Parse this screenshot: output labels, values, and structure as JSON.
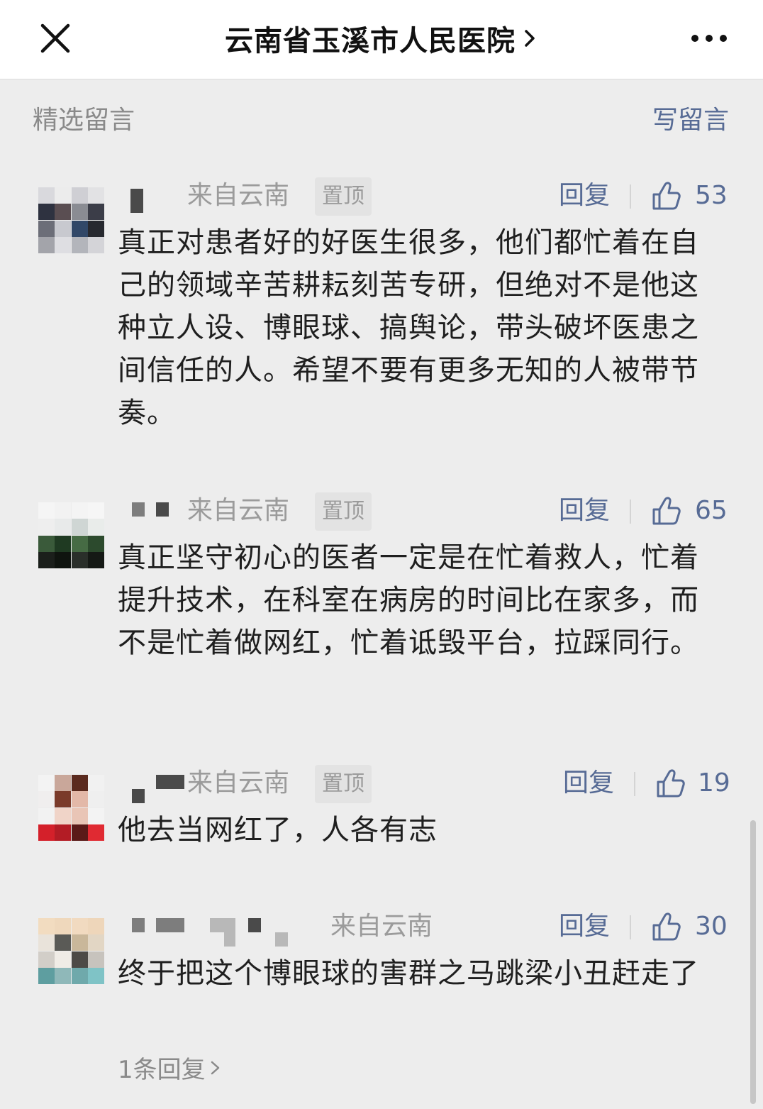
{
  "nav": {
    "title": "云南省玉溪市人民医院",
    "close_icon": "close-icon",
    "chevron_icon": "chevron-right-icon",
    "more_icon": "more-dots-icon"
  },
  "section": {
    "title": "精选留言",
    "write_label": "写留言"
  },
  "colors": {
    "link": "#576b95",
    "muted": "#9b9b9b",
    "background": "#ededed"
  },
  "comments": [
    {
      "location": "来自云南",
      "pinned_label": "置顶",
      "reply_label": "回复",
      "likes": "53",
      "text": "真正对患者好的好医生很多，他们都忙着在自己的领域辛苦耕耘刻苦专研，但绝对不是他这种立人设、博眼球、搞舆论，带头破坏医患之间信任的人。希望不要有更多无知的人被带节奏。"
    },
    {
      "location": "来自云南",
      "pinned_label": "置顶",
      "reply_label": "回复",
      "likes": "65",
      "text": "真正坚守初心的医者一定是在忙着救人，忙着提升技术，在科室在病房的时间比在家多，而不是忙着做网红，忙着诋毁平台，拉踩同行。"
    },
    {
      "location": "来自云南",
      "pinned_label": "置顶",
      "reply_label": "回复",
      "likes": "19",
      "text": "他去当网红了，人各有志"
    },
    {
      "location": "来自云南",
      "reply_label": "回复",
      "likes": "30",
      "text": "终于把这个博眼球的害群之马跳梁小丑赶走了",
      "sub_reply": "1条回复"
    }
  ]
}
